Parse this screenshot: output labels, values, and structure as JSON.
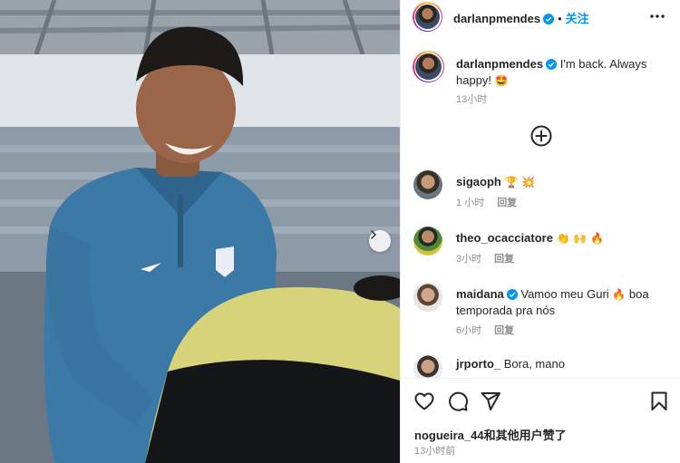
{
  "post": {
    "author": "darlanpmendes",
    "follow_label": "关注",
    "caption_author": "darlanpmendes",
    "caption_text": "I'm back. Always happy!",
    "caption_emoji": "🤩",
    "caption_time": "13小时",
    "liked_by": "nogueira_44和其他用户赞了",
    "posted_time": "13小时前"
  },
  "comments": [
    {
      "user": "sigaoph",
      "text": "",
      "emoji": "🏆 💥",
      "time": "1 小时",
      "reply": "回复"
    },
    {
      "user": "theo_ocacciatore",
      "text": "",
      "emoji": "👏 🙌 🔥",
      "time": "3小时",
      "reply": "回复"
    },
    {
      "user": "maidana",
      "text_before": "Vamoo meu Guri",
      "emoji": "🔥",
      "text_after": "boa temporada pra nós",
      "time": "6小时",
      "reply": "回复"
    },
    {
      "user": "jrporto_",
      "text": "Bora, mano"
    }
  ],
  "icons": {
    "more": "more-horizontal-icon",
    "add_comment": "add-circle-icon",
    "like": "heart-icon",
    "comment": "comment-icon",
    "share": "share-icon",
    "save": "bookmark-icon",
    "next": "chevron-right-icon"
  },
  "colors": {
    "accent": "#0095f6",
    "verified": "#0095f6",
    "muted": "#8e8e8e"
  }
}
